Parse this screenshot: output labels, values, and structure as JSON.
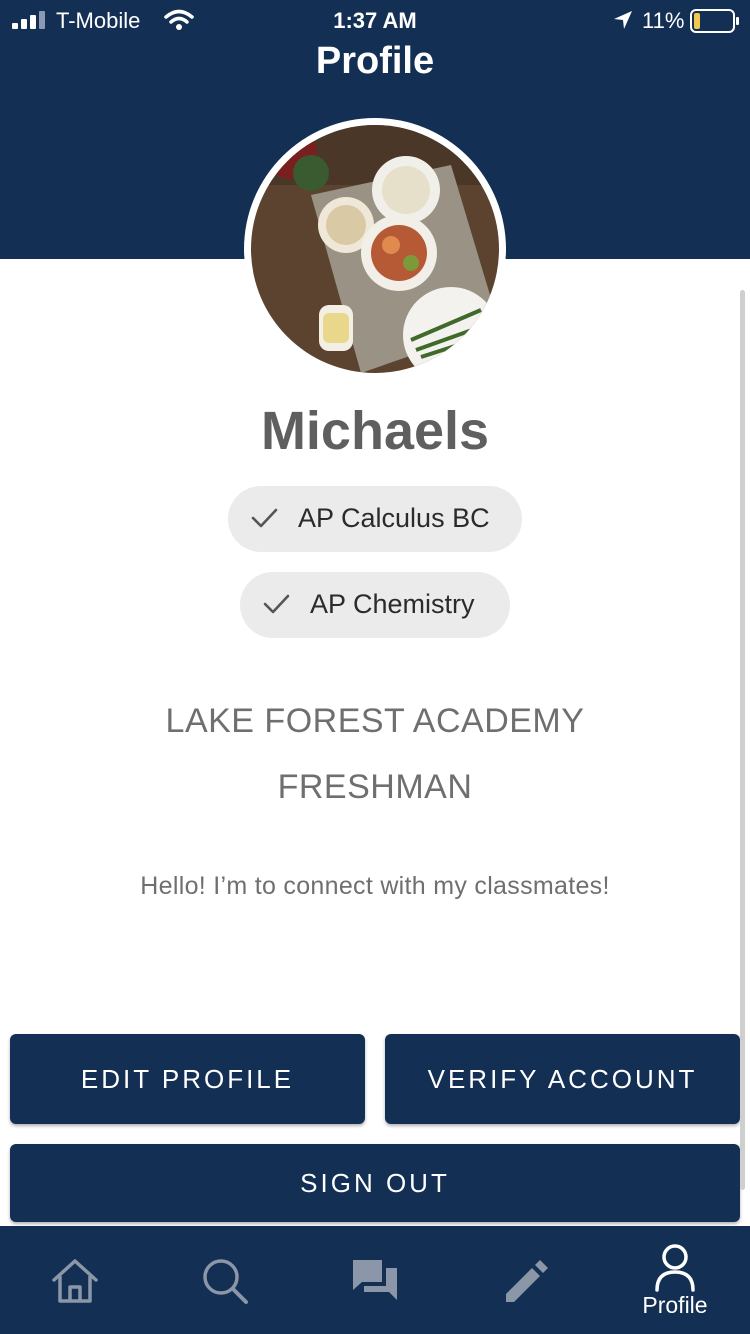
{
  "status_bar": {
    "carrier": "T-Mobile",
    "time": "1:37 AM",
    "battery": "11%"
  },
  "header": {
    "title": "Profile"
  },
  "profile": {
    "name": "Michaels",
    "courses": [
      "AP Calculus BC",
      "AP Chemistry"
    ],
    "school": "LAKE FOREST ACADEMY",
    "grade": "FRESHMAN",
    "bio": "Hello! I’m to connect with my classmates!"
  },
  "buttons": {
    "edit": "EDIT PROFILE",
    "verify": "VERIFY ACCOUNT",
    "sign_out": "SIGN OUT"
  },
  "tab_bar": {
    "items": [
      {
        "icon": "home-icon"
      },
      {
        "icon": "search-icon"
      },
      {
        "icon": "chat-icon"
      },
      {
        "icon": "pencil-icon"
      },
      {
        "icon": "person-icon",
        "label": "Profile",
        "active": true
      }
    ]
  },
  "colors": {
    "brand_navy": "#132f53",
    "chip_bg": "#ebebeb",
    "inactive_tab_icon": "#8b97a8"
  }
}
